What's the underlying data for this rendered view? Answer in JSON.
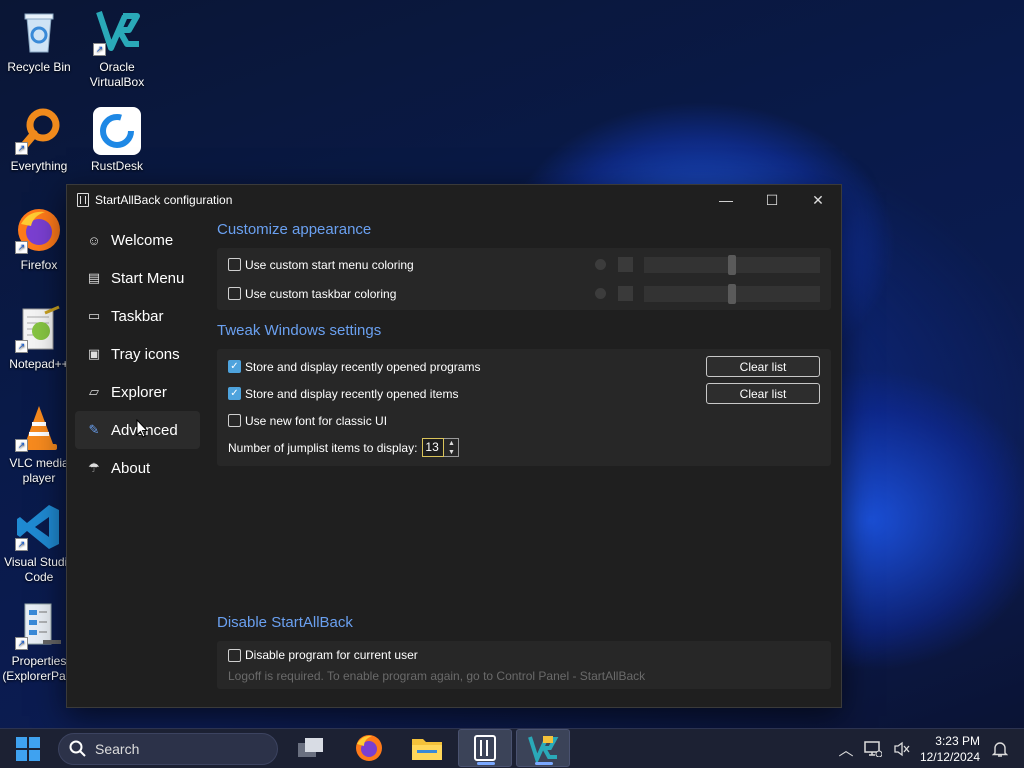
{
  "desktop_icons": [
    {
      "label": "Recycle Bin",
      "icon": "recycle-bin-icon"
    },
    {
      "label": "Oracle VirtualBox",
      "icon": "virtualbox-icon"
    },
    {
      "label": "Everything",
      "icon": "everything-search-icon"
    },
    {
      "label": "RustDesk",
      "icon": "rustdesk-icon"
    },
    {
      "label": "Firefox",
      "icon": "firefox-icon"
    },
    {
      "label": "Notepad++",
      "icon": "notepad-plus-plus-icon"
    },
    {
      "label": "VLC media player",
      "icon": "vlc-icon"
    },
    {
      "label": "Visual Studio Code",
      "icon": "vscode-icon"
    },
    {
      "label": "Properties (ExplorerPa...",
      "icon": "properties-icon"
    }
  ],
  "window": {
    "title": "StartAllBack configuration",
    "controls": {
      "minimize": "—",
      "maximize": "☐",
      "close": "✕"
    }
  },
  "nav": [
    {
      "label": "Welcome",
      "icon": "smiley-icon",
      "glyph": "☺"
    },
    {
      "label": "Start Menu",
      "icon": "start-menu-icon",
      "glyph": "▤"
    },
    {
      "label": "Taskbar",
      "icon": "taskbar-icon",
      "glyph": "▭"
    },
    {
      "label": "Tray icons",
      "icon": "tray-icons-icon",
      "glyph": "▣"
    },
    {
      "label": "Explorer",
      "icon": "folder-icon",
      "glyph": "▱"
    },
    {
      "label": "Advanced",
      "icon": "wrench-icon",
      "glyph": "✎"
    },
    {
      "label": "About",
      "icon": "about-icon",
      "glyph": "☂"
    }
  ],
  "sections": {
    "appearance": {
      "title": "Customize appearance",
      "items": [
        {
          "label": "Use custom start menu coloring",
          "checked": false,
          "slider_value_percent": 50
        },
        {
          "label": "Use custom taskbar coloring",
          "checked": false,
          "slider_value_percent": 50
        }
      ]
    },
    "tweak": {
      "title": "Tweak Windows settings",
      "items": [
        {
          "label": "Store and display recently opened programs",
          "checked": true,
          "button": "Clear list"
        },
        {
          "label": "Store and display recently opened items",
          "checked": true,
          "button": "Clear list"
        },
        {
          "label": "Use new font for classic UI",
          "checked": false
        }
      ],
      "jumplist_label": "Number of jumplist items to display:",
      "jumplist_value": "13"
    },
    "disable": {
      "title": "Disable StartAllBack",
      "item": {
        "label": "Disable program for current user",
        "checked": false
      },
      "hint": "Logoff is required. To enable program again, go to Control Panel - StartAllBack"
    }
  },
  "taskbar": {
    "search_placeholder": "Search",
    "time": "3:23 PM",
    "date": "12/12/2024",
    "pinned": [
      "task-view-icon",
      "firefox-icon",
      "file-explorer-icon",
      "startallback-icon",
      "virtualbox-icon"
    ]
  },
  "colors": {
    "accent": "#6aa0f0",
    "checkbox": "#4ea3dd"
  }
}
